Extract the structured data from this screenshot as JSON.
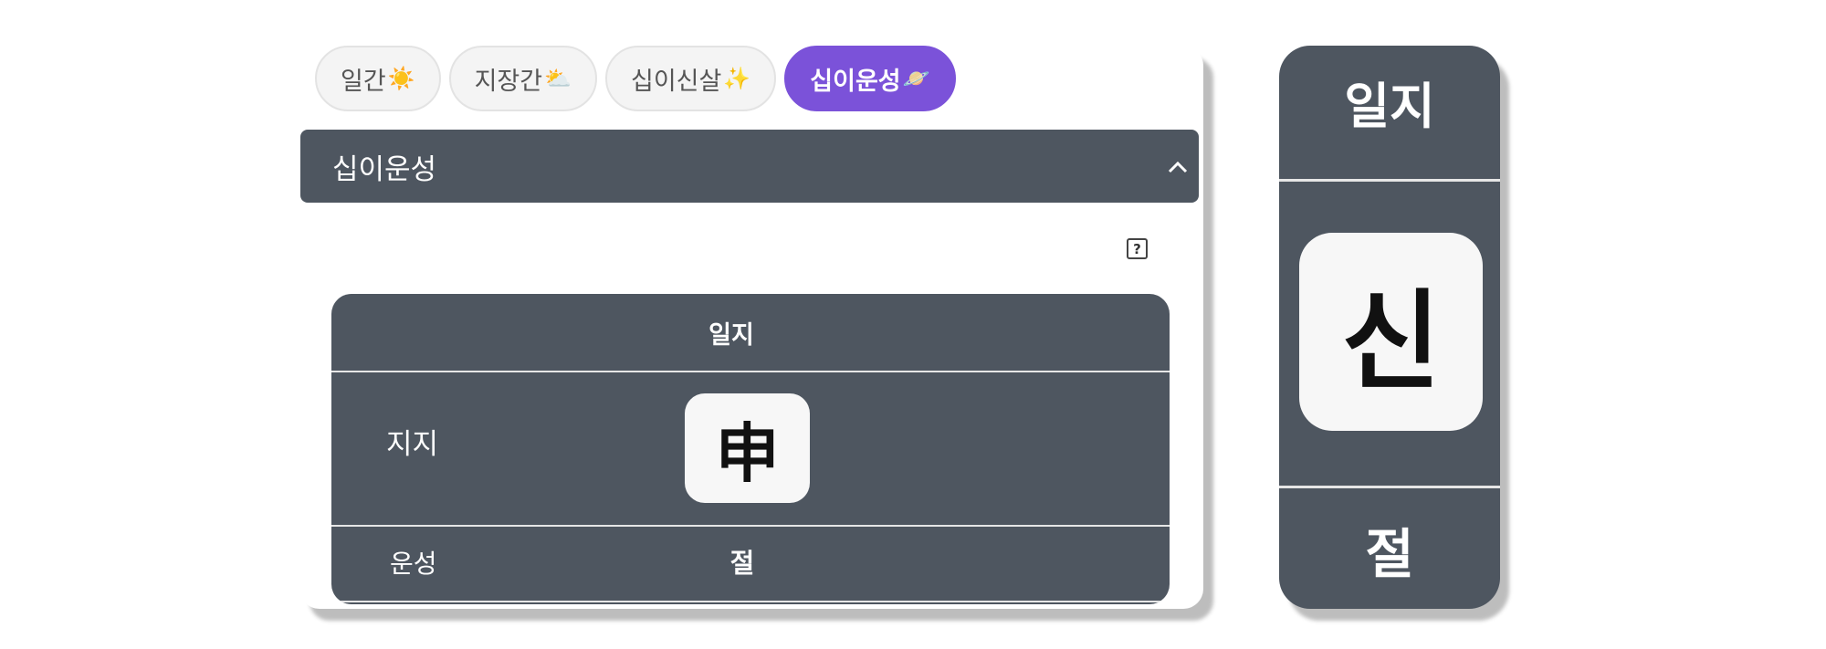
{
  "tabs": [
    {
      "label": "일간",
      "emoji": "☀️",
      "active": false
    },
    {
      "label": "지장간",
      "emoji": "⛅",
      "active": false
    },
    {
      "label": "십이신살",
      "emoji": "✨",
      "active": false
    },
    {
      "label": "십이운성",
      "emoji": "🪐",
      "active": true
    }
  ],
  "accordion": {
    "title": "십이운성",
    "icon": "chevron-up-icon"
  },
  "help": {
    "glyph": "?",
    "icon": "help-icon"
  },
  "table": {
    "header": "일지",
    "rows": [
      {
        "label": "지지",
        "value": "申"
      },
      {
        "label": "운성",
        "value": "절"
      }
    ]
  },
  "zoom_card": {
    "title": "일지",
    "character": "신",
    "bottom": "절"
  },
  "colors": {
    "panel": "#4e5660",
    "accent": "#7b52d9",
    "tile": "#f7f7f7"
  }
}
